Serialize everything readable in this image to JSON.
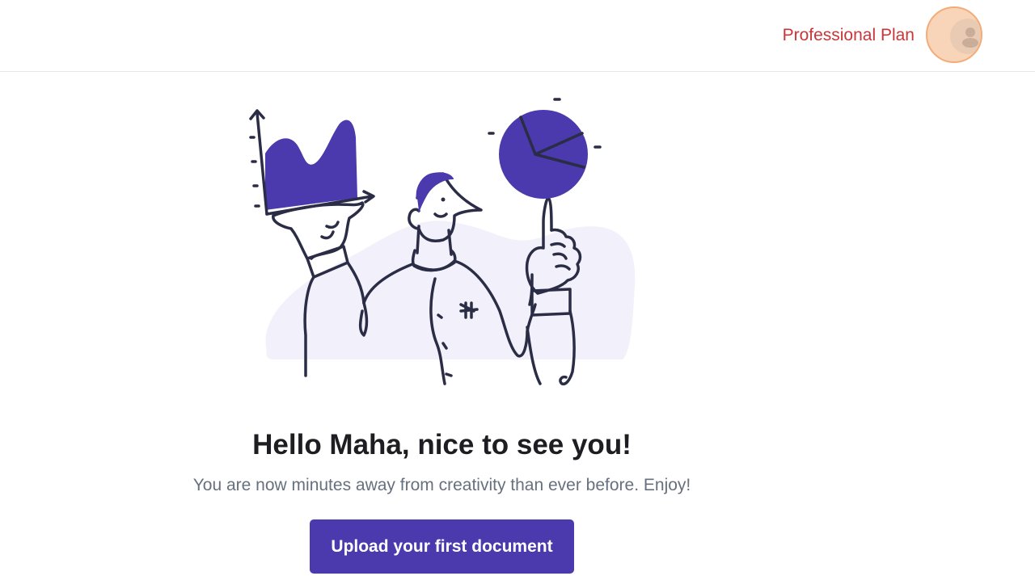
{
  "header": {
    "plan_label": "Professional Plan",
    "avatar_icon": "user-avatar-icon"
  },
  "main": {
    "illustration_icon": "analytics-person-illustration",
    "headline": "Hello Maha, nice to see you!",
    "subline": "You are now minutes away from creativity than ever before. Enjoy!",
    "upload_button_label": "Upload your first document"
  },
  "colors": {
    "accent": "#4a3aad",
    "plan_text": "#c8363a",
    "avatar_fill": "#f8d5b8",
    "avatar_border": "#f3ab77",
    "headline_text": "#1d1d22",
    "subline_text": "#67707f"
  }
}
